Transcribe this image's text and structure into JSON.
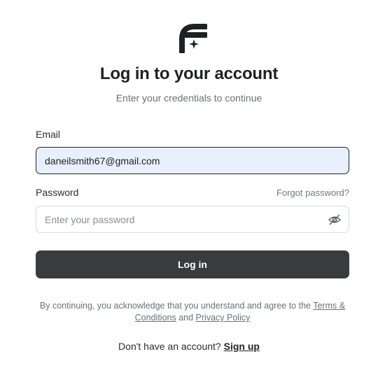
{
  "brand": {
    "logo_icon": "f-sparkle-logo-icon",
    "color": "#1f2024"
  },
  "header": {
    "title": "Log in to your account",
    "subtitle": "Enter your credentials to continue"
  },
  "form": {
    "email_label": "Email",
    "email_value": "daneilsmith67@gmail.com",
    "password_label": "Password",
    "forgot_password": "Forgot password?",
    "password_placeholder": "Enter your password",
    "toggle_icon": "eye-off-icon",
    "submit_label": "Log in"
  },
  "legal": {
    "prefix": "By continuing, you acknowledge that you understand and agree to the ",
    "terms_link": "Terms & Conditions",
    "and": " and ",
    "privacy_link": "Privacy Policy"
  },
  "footer": {
    "prompt": "Don't have an account? ",
    "signup_link": "Sign up"
  },
  "colors": {
    "primary_button": "#3a3b3f",
    "autofill_bg": "#e8f0fe",
    "muted_text": "#6b6f76"
  }
}
